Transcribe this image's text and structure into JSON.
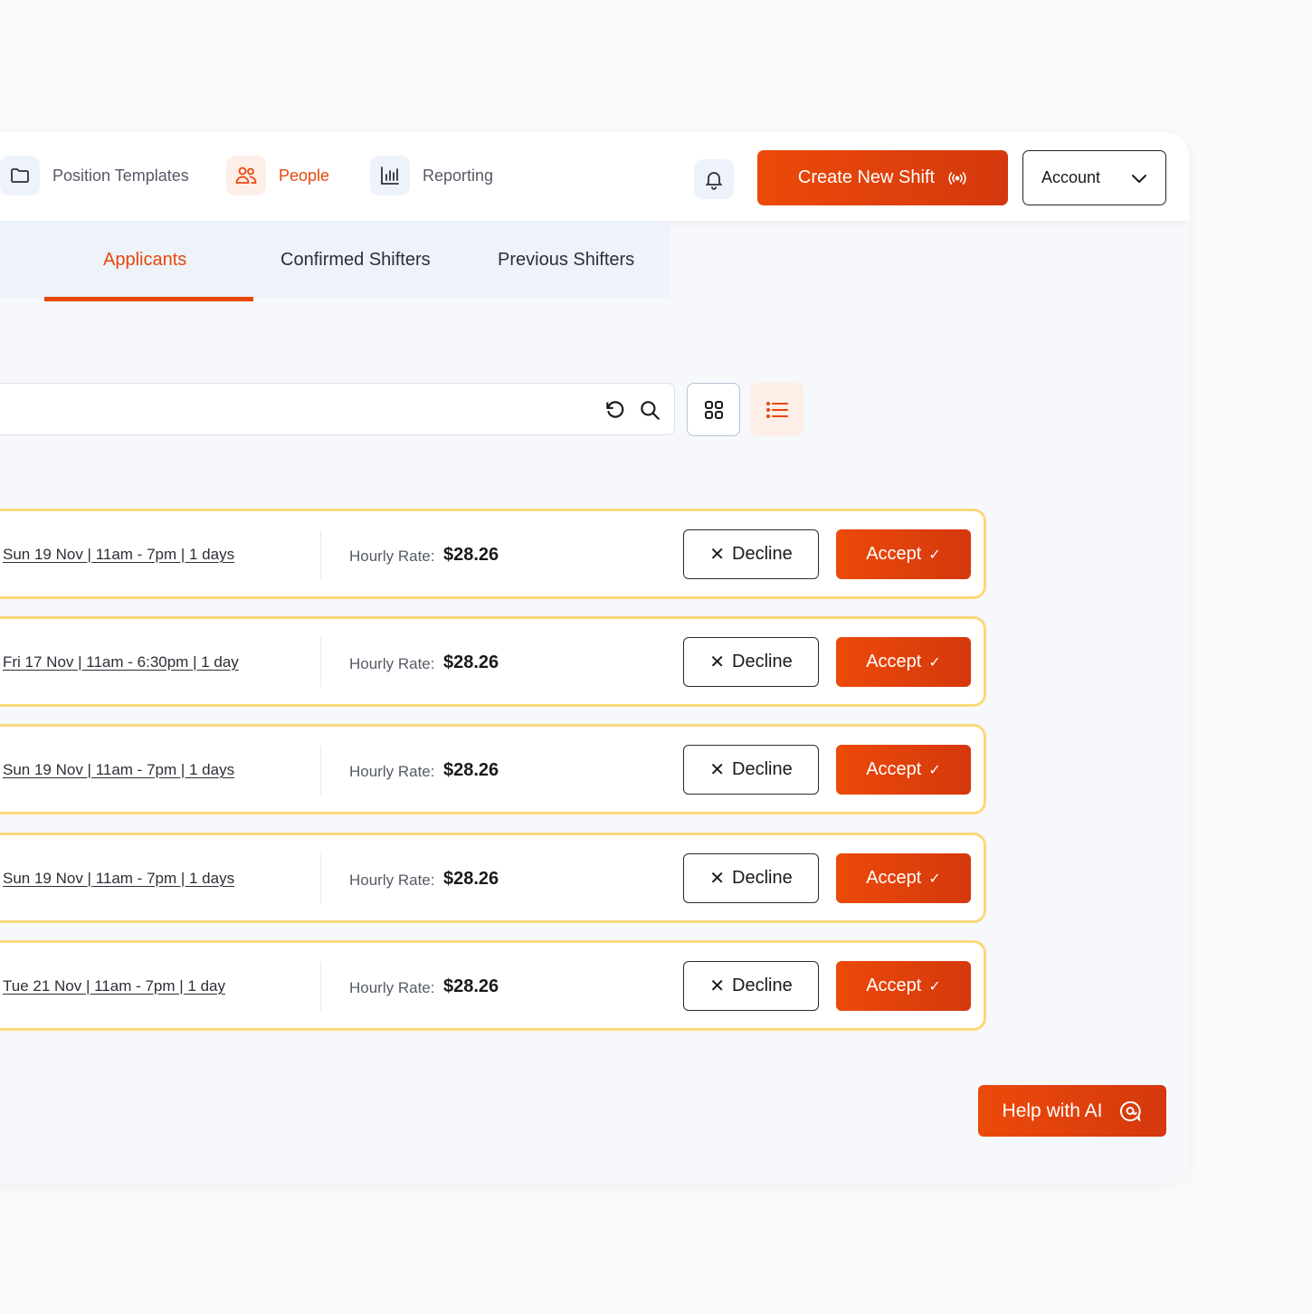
{
  "nav": {
    "items": [
      {
        "label": "Position Templates",
        "icon": "folder-icon"
      },
      {
        "label": "People",
        "icon": "people-icon"
      },
      {
        "label": "Reporting",
        "icon": "bar-chart-icon"
      }
    ],
    "create_label": "Create New Shift",
    "account_label": "Account"
  },
  "tabs": {
    "partial": "y",
    "items": [
      "Applicants",
      "Confirmed Shifters",
      "Previous Shifters"
    ],
    "active": "Applicants"
  },
  "search": {
    "placeholder": ""
  },
  "rows": [
    {
      "date": "Sun 19 Nov  |  11am - 7pm  |  1 days",
      "rate_label": "Hourly Rate:",
      "rate": "$28.26",
      "decline": "Decline",
      "accept": "Accept"
    },
    {
      "date": "Fri 17 Nov  |  11am - 6:30pm  |  1 day",
      "rate_label": "Hourly Rate:",
      "rate": "$28.26",
      "decline": "Decline",
      "accept": "Accept"
    },
    {
      "date": "Sun 19 Nov  |  11am - 7pm  |  1 days",
      "rate_label": "Hourly Rate:",
      "rate": "$28.26",
      "decline": "Decline",
      "accept": "Accept"
    },
    {
      "date": "Sun 19 Nov  |  11am - 7pm  |  1 days",
      "rate_label": "Hourly Rate:",
      "rate": "$28.26",
      "decline": "Decline",
      "accept": "Accept"
    },
    {
      "date": "Tue 21 Nov  |  11am - 7pm  |  1 day",
      "rate_label": "Hourly Rate:",
      "rate": "$28.26",
      "decline": "Decline",
      "accept": "Accept"
    }
  ],
  "help_label": "Help with AI",
  "colors": {
    "accent": "#e8470c",
    "row_border": "#fbd87a",
    "tab_bg": "#eef2f9"
  }
}
